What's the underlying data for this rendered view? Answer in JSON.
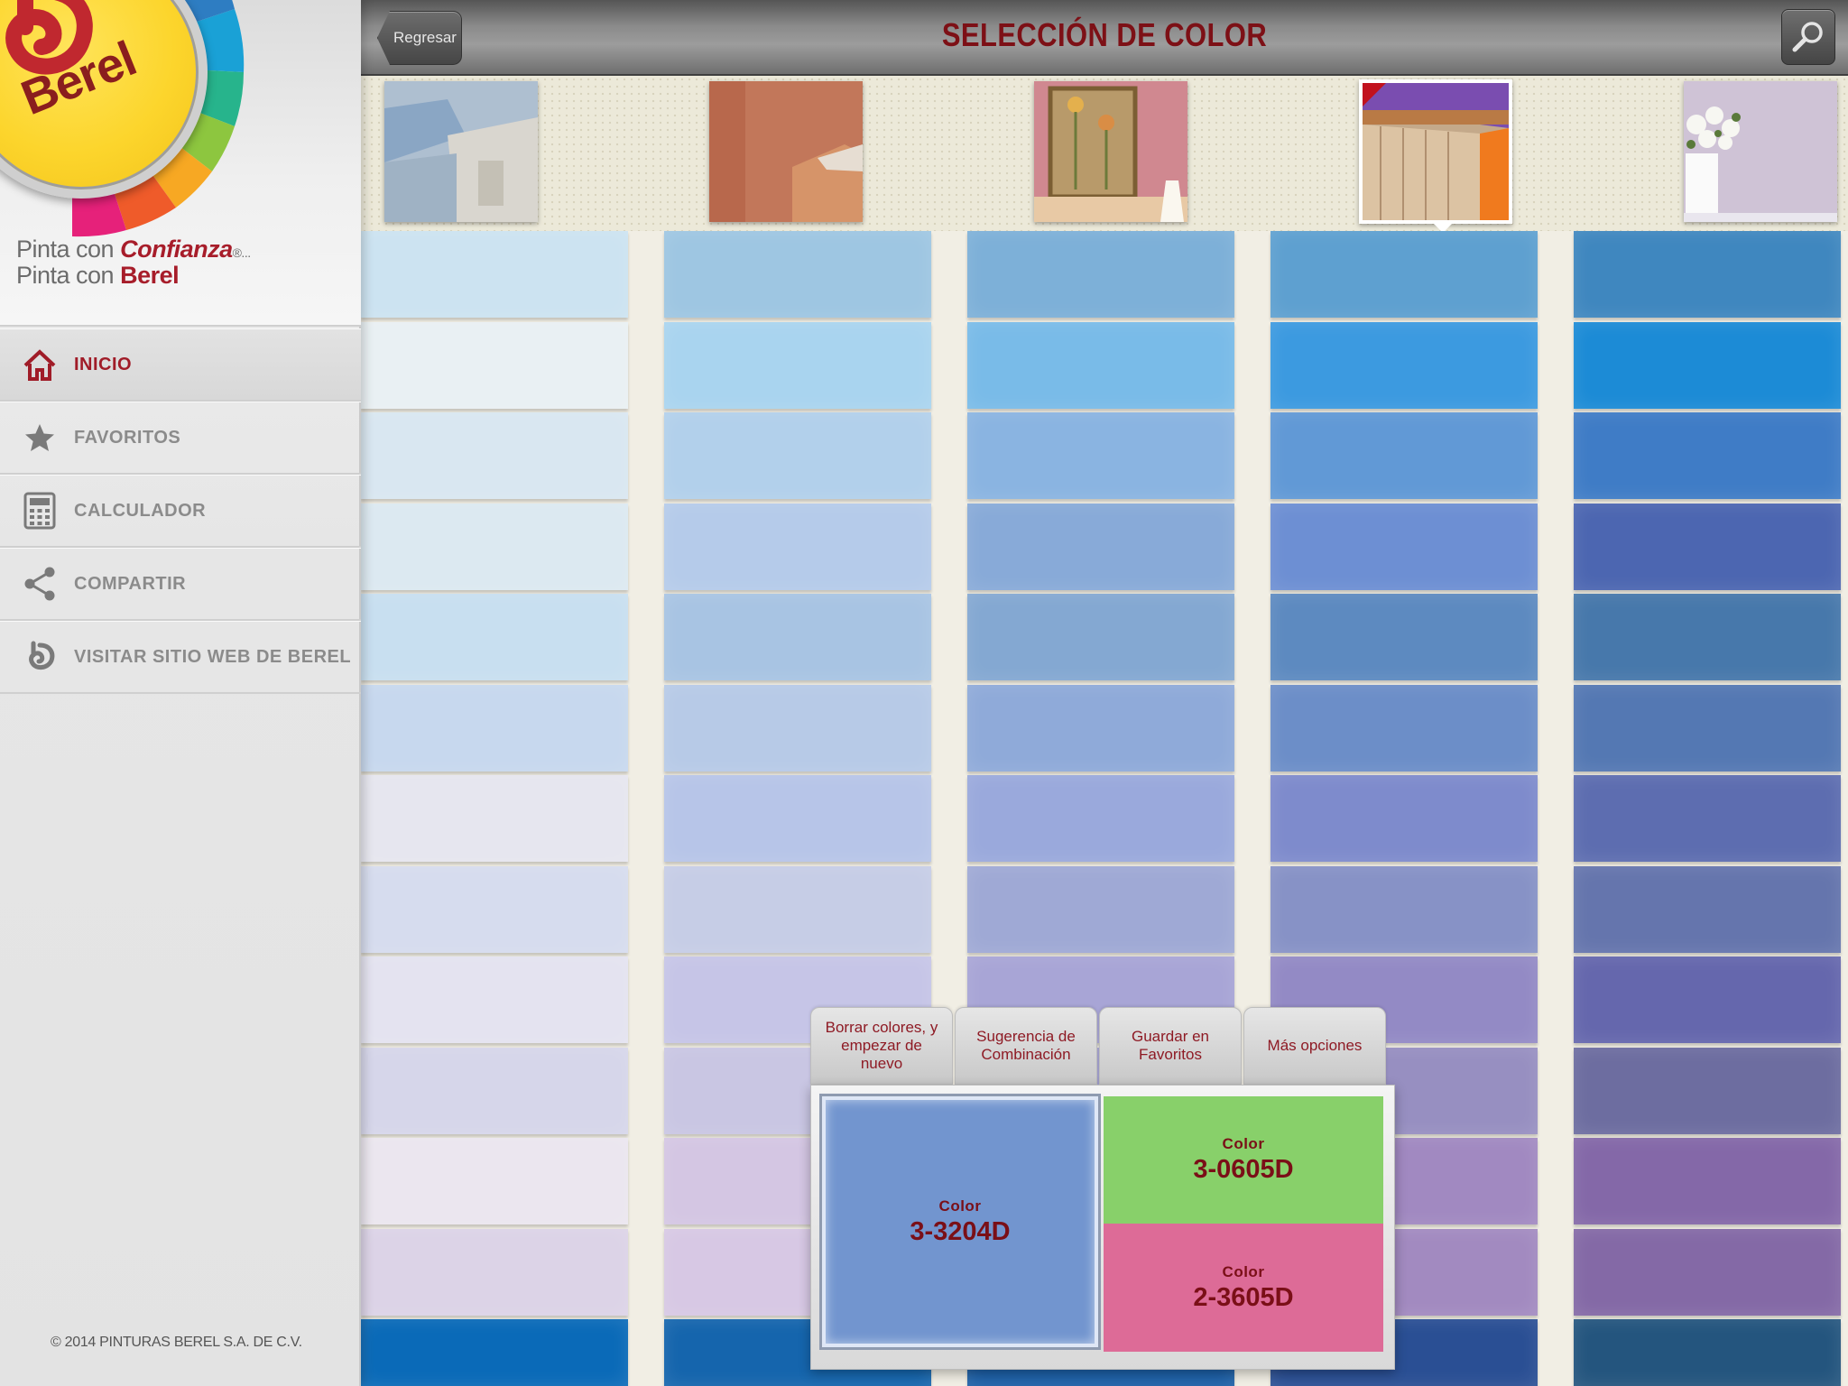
{
  "app": {
    "brand": "Berel",
    "tagline_line1_prefix": "Pinta con",
    "tagline_line1_highlight": "Confianza",
    "tagline_line1_suffix": "®...",
    "tagline_line2_prefix": "Pinta con",
    "tagline_line2_highlight": "Berel",
    "copyright": "© 2014 PINTURAS BEREL S.A. DE C.V."
  },
  "sidebar": {
    "items": [
      {
        "label": "INICIO",
        "icon": "home-icon",
        "active": true
      },
      {
        "label": "FAVORITOS",
        "icon": "star-icon",
        "active": false
      },
      {
        "label": "CALCULADOR",
        "icon": "calculator-icon",
        "active": false
      },
      {
        "label": "COMPARTIR",
        "icon": "share-icon",
        "active": false
      },
      {
        "label": "VISITAR SITIO WEB DE BEREL",
        "icon": "berel-swirl-icon",
        "active": false
      }
    ]
  },
  "header": {
    "back_label": "Regresar",
    "title": "SELECCIÓN DE COLOR",
    "search_icon": "search-icon"
  },
  "rooms": {
    "selected_index": 3,
    "thumbs": [
      "exterior-facade",
      "terracotta-wall",
      "pink-wall-with-painting",
      "purple-ceiling-room",
      "lilac-wall-with-flowers"
    ]
  },
  "swatch_grid": {
    "columns": [
      [
        "#cce3f1",
        "#e9f0f3",
        "#d9e7f1",
        "#dce9f1",
        "#c8dff0",
        "#c7d8ee",
        "#e6e6ef",
        "#d6dcee",
        "#e4e3f0",
        "#d6d6ea",
        "#ebe6ef",
        "#dcd3e7",
        "#0a6ab8"
      ],
      [
        "#9ec6e2",
        "#a9d4ef",
        "#b2d0eb",
        "#b5cbea",
        "#a8c4e3",
        "#b7cae7",
        "#b7c5e8",
        "#c6cde6",
        "#c6c5e7",
        "#c9c6e3",
        "#d4c6e3",
        "#d7c8e4",
        "#1565ad"
      ],
      [
        "#7db0d8",
        "#79bbe8",
        "#8ab4e1",
        "#88aad8",
        "#84a8d2",
        "#8faad9",
        "#9aa9dc",
        "#9fa9d5",
        "#a8a5d6",
        "#a7a4d3",
        "#b3a3d4",
        "#b7a5d4",
        "#1c5fa6"
      ],
      [
        "#5ea0d0",
        "#3c9ae0",
        "#6199d6",
        "#6d8fd3",
        "#5d8ac0",
        "#6c8ec8",
        "#7e8bcc",
        "#8792c6",
        "#938ac5",
        "#978fc1",
        "#a189c1",
        "#a28ac0",
        "#2a4f94"
      ],
      [
        "#3f87bf",
        "#1c8bd6",
        "#3f7cc6",
        "#4c66b1",
        "#4778ab",
        "#5478b3",
        "#5d6db0",
        "#6575ad",
        "#6567ad",
        "#6d6da0",
        "#8468a8",
        "#8469a6",
        "#24557e"
      ]
    ]
  },
  "popup": {
    "tabs": [
      {
        "label": "Borrar colores, y empezar de nuevo"
      },
      {
        "label": "Sugerencia de Combinación"
      },
      {
        "label": "Guardar en Favoritos"
      },
      {
        "label": "Más opciones"
      }
    ],
    "colors": [
      {
        "label": "Color",
        "code": "3-3204D",
        "hex": "#7295cf"
      },
      {
        "label": "Color",
        "code": "3-0605D",
        "hex": "#88d06a"
      },
      {
        "label": "Color",
        "code": "2-3605D",
        "hex": "#dd6b97"
      }
    ]
  },
  "colors": {
    "accent": "#a01c28",
    "title": "#7d1016",
    "brand_yellow": "#fcd52c"
  }
}
